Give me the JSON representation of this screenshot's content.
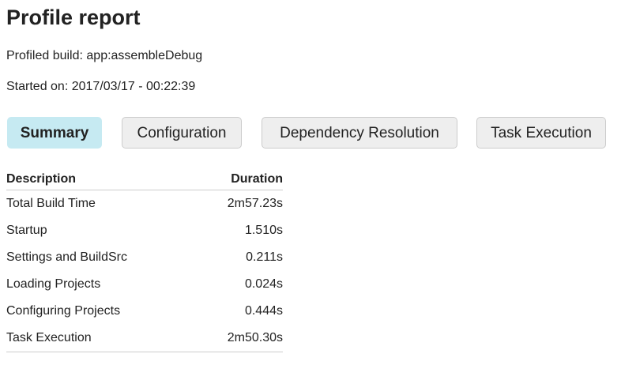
{
  "page": {
    "title": "Profile report",
    "profiled_build": "Profiled build: app:assembleDebug",
    "started_on": "Started on: 2017/03/17 - 00:22:39"
  },
  "tabs": [
    {
      "label": "Summary",
      "active": true
    },
    {
      "label": "Configuration",
      "active": false
    },
    {
      "label": "Dependency Resolution",
      "active": false
    },
    {
      "label": "Task Execution",
      "active": false
    }
  ],
  "summary_table": {
    "headers": {
      "description": "Description",
      "duration": "Duration"
    },
    "rows": [
      {
        "description": "Total Build Time",
        "duration": "2m57.23s"
      },
      {
        "description": "Startup",
        "duration": "1.510s"
      },
      {
        "description": "Settings and BuildSrc",
        "duration": "0.211s"
      },
      {
        "description": "Loading Projects",
        "duration": "0.024s"
      },
      {
        "description": "Configuring Projects",
        "duration": "0.444s"
      },
      {
        "description": "Task Execution",
        "duration": "2m50.30s"
      }
    ]
  },
  "colors": {
    "active_tab_bg": "#c6eaf2",
    "inactive_tab_bg": "#eeeeee",
    "divider": "#cccccc",
    "text": "#222222"
  }
}
